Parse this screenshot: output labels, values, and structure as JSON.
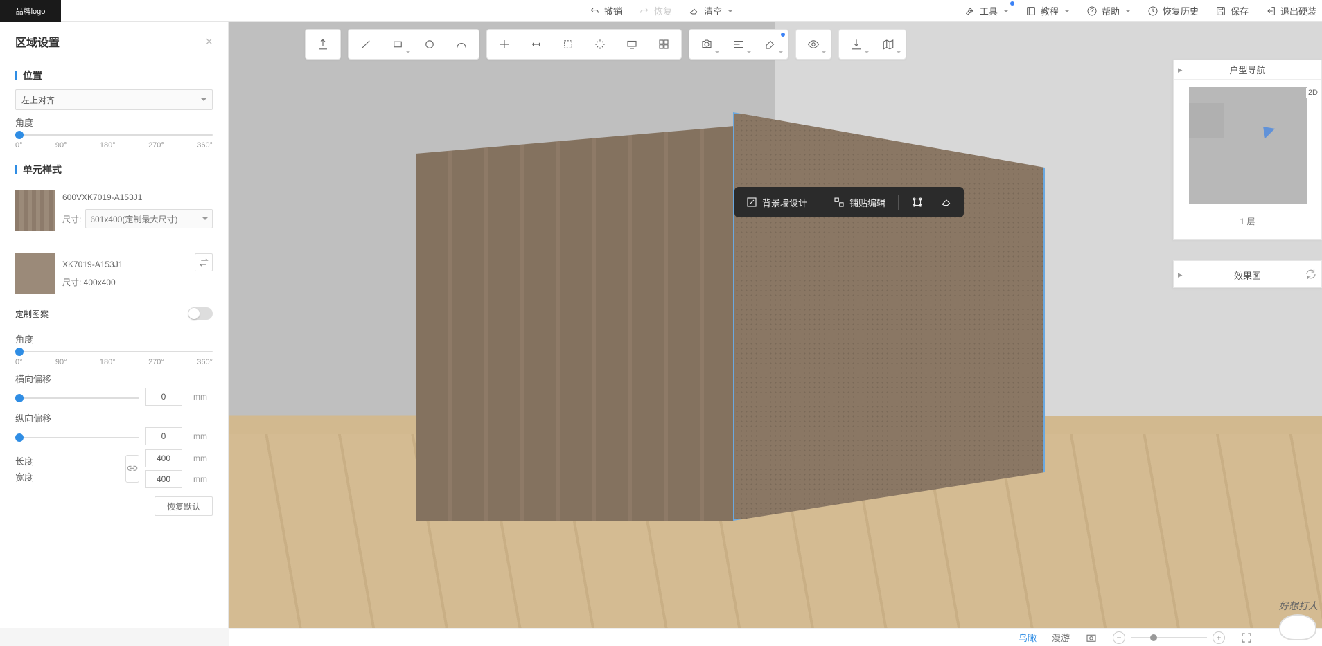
{
  "logo_text": "品牌logo",
  "header": {
    "undo": "撤销",
    "redo": "恢复",
    "clear": "清空",
    "tools": "工具",
    "tutorial": "教程",
    "help": "帮助",
    "history": "恢复历史",
    "save": "保存",
    "exit": "退出硬装"
  },
  "sidebar": {
    "title": "区域设置",
    "pos_section": "位置",
    "align_value": "左上对齐",
    "angle_label": "角度",
    "ticks": [
      "0°",
      "90°",
      "180°",
      "270°",
      "360°"
    ],
    "unit_section": "单元样式",
    "mat1_name": "600VXK7019-A153J1",
    "size_label": "尺寸:",
    "mat1_size": "601x400(定制最大尺寸)",
    "mat2_name": "XK7019-A153J1",
    "mat2_size": "尺寸: 400x400",
    "custom_pattern": "定制图案",
    "angle2": "角度",
    "hoffset": "横向偏移",
    "voffset": "纵向偏移",
    "length": "长度",
    "width": "宽度",
    "hoffset_val": "0",
    "voffset_val": "0",
    "length_val": "400",
    "width_val": "400",
    "mm": "mm",
    "reset": "恢复默认"
  },
  "context": {
    "wall_design": "背景墙设计",
    "tile_edit": "铺贴编辑"
  },
  "right": {
    "nav_title": "户型导航",
    "floor_label": "1 层",
    "map_2d": "2D",
    "render_title": "效果图"
  },
  "bottom": {
    "bird": "鸟瞰",
    "roam": "漫游"
  },
  "mascot": "好想打人"
}
